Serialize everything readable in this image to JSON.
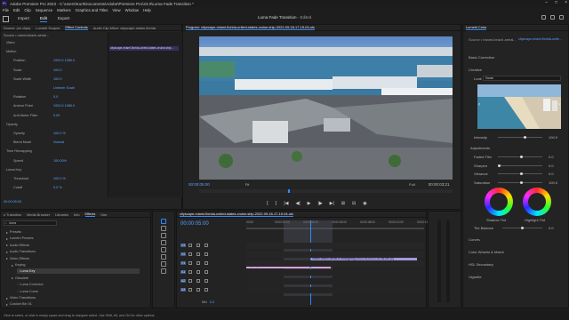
{
  "titlebar": {
    "logo": "Pr",
    "title": "Adobe Premiere Pro 2023 - C:\\Users\\Kurt\\Documents\\Adobe\\Premiere Pro\\23.0\\Luma Fade Transition *"
  },
  "menu": [
    "File",
    "Edit",
    "Clip",
    "Sequence",
    "Markers",
    "Graphics and Titles",
    "View",
    "Window",
    "Help"
  ],
  "workspace": {
    "tabs": [
      "Import",
      "Edit",
      "Export"
    ],
    "active": "Edit",
    "project": "Luma Fade Transition",
    "status": "- Edited"
  },
  "source_panel": {
    "tabs": [
      "Source: (no clips)",
      "Lumetri Scopes",
      "Effect Controls",
      "Audio Clip Mixer: cityscape-miami-florida"
    ],
    "active_tab": "Effect Controls",
    "master": "Source • miami-beach-aerial...",
    "clip_ref": "cityscape-miami-florida-united-states-cruise-ship...",
    "timecode": "00:00:05:00",
    "rows": [
      {
        "label": "Video",
        "value": ""
      },
      {
        "label": "Motion",
        "value": ""
      },
      {
        "label": "Position",
        "value": "1920.0   1080.0"
      },
      {
        "label": "Scale",
        "value": "100.0"
      },
      {
        "label": "Scale Width",
        "value": "100.0"
      },
      {
        "label": "",
        "value": "Uniform Scale"
      },
      {
        "label": "Rotation",
        "value": "0.0"
      },
      {
        "label": "Anchor Point",
        "value": "1920.0   1080.0"
      },
      {
        "label": "Anti-flicker Filter",
        "value": "0.00"
      },
      {
        "label": "Opacity",
        "value": ""
      },
      {
        "label": "Opacity",
        "value": "100.0 %"
      },
      {
        "label": "Blend Mode",
        "value": "Normal"
      },
      {
        "label": "Time Remapping",
        "value": ""
      },
      {
        "label": "Speed",
        "value": "100.00%"
      },
      {
        "label": "Luma Key",
        "value": ""
      },
      {
        "label": "Threshold",
        "value": "100.0 %"
      },
      {
        "label": "Cutoff",
        "value": "0.0 %"
      }
    ],
    "footer_tc": "00:00:05:00"
  },
  "program": {
    "tab": "Program: cityscape-miami-florida-united-states-cruise-ship-2022-09-18-17-15-04-utc",
    "timecode": "00:00:05:00",
    "fit": "Fit",
    "quality": "Full",
    "duration": "00:00:03;21"
  },
  "effects_panel": {
    "tabs": [
      "n Transition",
      "Media Browser",
      "Libraries",
      "Info",
      "Effects",
      "Mar"
    ],
    "active_tab": "Effects",
    "search": "luma",
    "tree": [
      {
        "label": "Presets",
        "indent": 0
      },
      {
        "label": "Lumetri Presets",
        "indent": 0
      },
      {
        "label": "Audio Effects",
        "indent": 0
      },
      {
        "label": "Audio Transitions",
        "indent": 0
      },
      {
        "label": "Video Effects",
        "indent": 0
      },
      {
        "label": "Keying",
        "indent": 1
      },
      {
        "label": "Luma Key",
        "indent": 2,
        "selected": true
      },
      {
        "label": "Obsolete",
        "indent": 1
      },
      {
        "label": "Luma Corrector",
        "indent": 2
      },
      {
        "label": "Luma Curve",
        "indent": 2
      },
      {
        "label": "Video Transitions",
        "indent": 0
      },
      {
        "label": "Custom Bin 01",
        "indent": 0
      }
    ]
  },
  "timeline": {
    "tab": "cityscape-miami-florida-united-states-cruise-ship-2022-09-18-17-15-04-utc",
    "timecode": "00:00:05:00",
    "ruler": [
      "00:00",
      "00:00:02:00",
      "00:00:04:00",
      "00:00:06:00",
      "00:00:08:00",
      "00:00:10:00",
      "00:00:12:00"
    ],
    "tracks": [
      "V3",
      "V2",
      "V1",
      "A1",
      "A2",
      "A3"
    ],
    "clips": [
      {
        "label": "miami-beach-aerial-fx-emergency-2022-04-04-21-42-58-utc [V]",
        "track": "V2"
      },
      {
        "label": "cityscape-miami-florida-united-states-cruise-ship-2022-09...",
        "track": "V1"
      }
    ],
    "mix": "Mix",
    "mix_value": "0.0"
  },
  "lumetri": {
    "tab": "Lumetri Color",
    "source": "Source • miami-beach-aerial...",
    "clip": "cityscape-miami-florida-unite...",
    "sections": [
      "Basic Correction",
      "Creative",
      "Curves",
      "Color Wheels & Match",
      "HSL Secondary",
      "Vignette"
    ],
    "look_label": "Look",
    "look_value": "None",
    "intensity": {
      "label": "Intensity",
      "value": "100.0"
    },
    "adjustments": "Adjustments",
    "adj_rows": [
      {
        "label": "Faded Film",
        "value": "0.0"
      },
      {
        "label": "Sharpen",
        "value": "0.0"
      },
      {
        "label": "Vibrance",
        "value": "0.0"
      },
      {
        "label": "Saturation",
        "value": "100.0"
      }
    ],
    "shadow_tint": "Shadow Tint",
    "highlight_tint": "Highlight Tint",
    "tint_balance": {
      "label": "Tint Balance",
      "value": "0.0"
    }
  },
  "status": "Click to select, or click in empty space and drag to marquee select. Use Shift, Alt, and Ctrl for other options.",
  "colors": {
    "accent": "#2e8bff",
    "clip_v2": "#a399dd",
    "clip_v1": "#d6a2db",
    "panel": "#232323"
  }
}
